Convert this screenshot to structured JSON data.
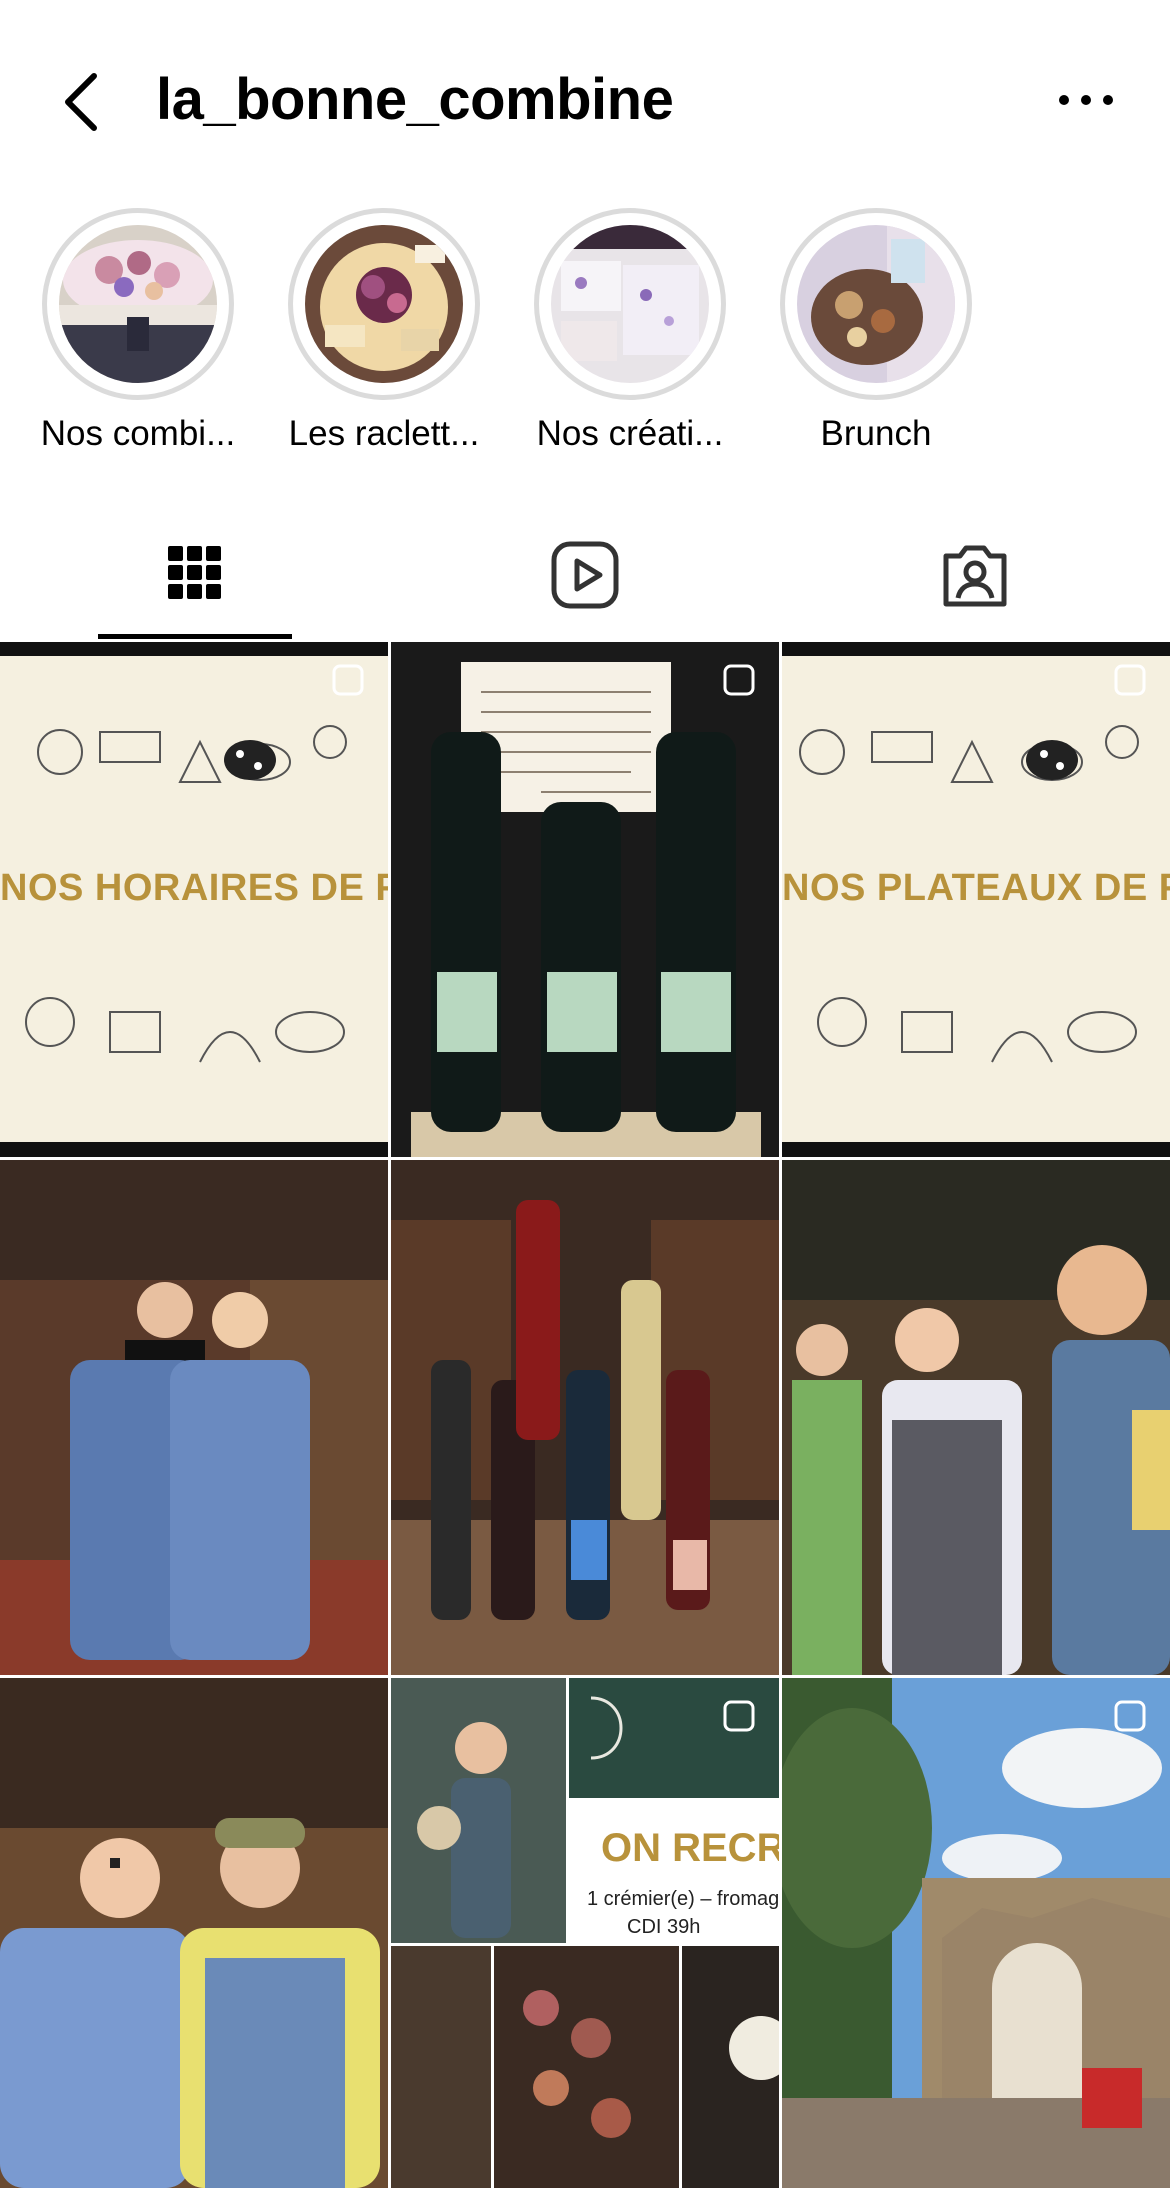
{
  "header": {
    "username": "la_bonne_combine",
    "back_icon": "chevron-left-icon",
    "more_icon": "more-horizontal-icon"
  },
  "highlights": [
    {
      "label": "Nos combi...",
      "palette": [
        "#f4e8ec",
        "#c98aa0",
        "#3a3a5a"
      ]
    },
    {
      "label": "Les raclett...",
      "palette": [
        "#f3e0b8",
        "#8a4a6a",
        "#d9b07a"
      ]
    },
    {
      "label": "Nos créati...",
      "palette": [
        "#f1eef4",
        "#b8a5cf",
        "#e8e0d8"
      ]
    },
    {
      "label": "Brunch",
      "palette": [
        "#e6e6ee",
        "#8a5a3a",
        "#c8a070"
      ]
    }
  ],
  "tabs": [
    {
      "name": "posts",
      "icon": "grid-icon",
      "active": true
    },
    {
      "name": "reels",
      "icon": "reels-play-icon",
      "active": false
    },
    {
      "name": "tagged",
      "icon": "tagged-person-icon",
      "active": false
    }
  ],
  "grid": {
    "posts": [
      {
        "type": "poster",
        "text": "NOS HORAIRES DE FÊTES",
        "multi": true
      },
      {
        "type": "photo",
        "scene": "wine bottles with handwritten note",
        "multi": true
      },
      {
        "type": "poster",
        "text": "NOS PLATEAUX DE FÊTES",
        "multi": true
      },
      {
        "type": "photo",
        "scene": "two people in aprons in shop",
        "multi": false
      },
      {
        "type": "photo",
        "scene": "wine bottles on table in cellar",
        "multi": false
      },
      {
        "type": "photo",
        "scene": "three people waving in shop",
        "multi": false
      },
      {
        "type": "photo",
        "scene": "two people smiling in aprons",
        "multi": false
      },
      {
        "type": "recruit",
        "title": "ON RECRUT",
        "line1": "1 crémier(e) – fromag",
        "line2": "CDI 39h",
        "multi": true
      },
      {
        "type": "photo",
        "scene": "stone arch village",
        "multi": true
      }
    ]
  }
}
